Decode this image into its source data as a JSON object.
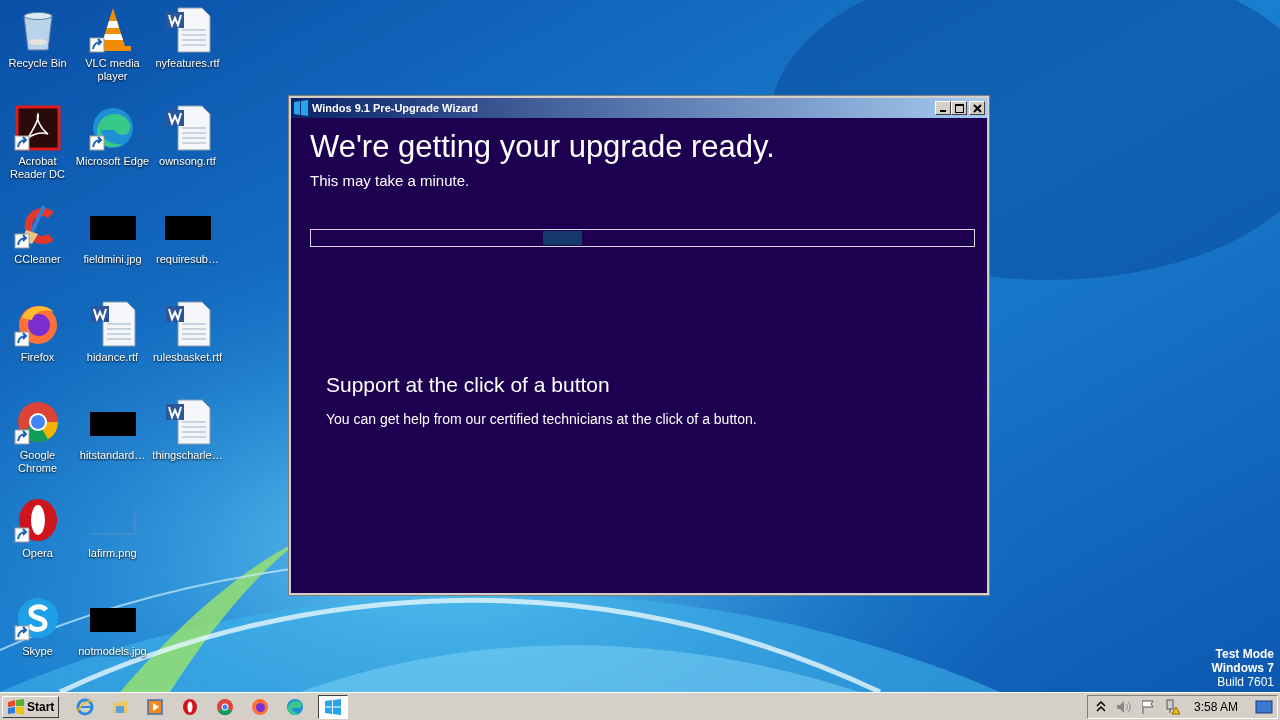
{
  "desktop": {
    "icons": [
      {
        "label": "Recycle Bin",
        "kind": "recycle",
        "shortcut": false
      },
      {
        "label": "Acrobat Reader DC",
        "kind": "acrobat",
        "shortcut": true
      },
      {
        "label": "CCleaner",
        "kind": "ccleaner",
        "shortcut": true
      },
      {
        "label": "Firefox",
        "kind": "firefox",
        "shortcut": true
      },
      {
        "label": "Google Chrome",
        "kind": "chrome",
        "shortcut": true
      },
      {
        "label": "Opera",
        "kind": "opera",
        "shortcut": true
      },
      {
        "label": "Skype",
        "kind": "skype",
        "shortcut": true
      },
      {
        "label": "VLC media player",
        "kind": "vlc",
        "shortcut": true
      },
      {
        "label": "Microsoft Edge",
        "kind": "edge",
        "shortcut": true
      },
      {
        "label": "fieldmini.jpg",
        "kind": "thumb-black",
        "shortcut": false
      },
      {
        "label": "hidance.rtf",
        "kind": "word",
        "shortcut": false
      },
      {
        "label": "hitstandard…",
        "kind": "thumb-black",
        "shortcut": false
      },
      {
        "label": "lafirm.png",
        "kind": "thumb-blank",
        "shortcut": false
      },
      {
        "label": "notmodels.jpg",
        "kind": "thumb-black",
        "shortcut": false
      },
      {
        "label": "nyfeatures.rtf",
        "kind": "word",
        "shortcut": false
      },
      {
        "label": "ownsong.rtf",
        "kind": "word",
        "shortcut": false
      },
      {
        "label": "requiresub…",
        "kind": "thumb-black",
        "shortcut": false
      },
      {
        "label": "rulesbasket.rtf",
        "kind": "word",
        "shortcut": false
      },
      {
        "label": "thingscharle…",
        "kind": "word",
        "shortcut": false
      }
    ]
  },
  "window": {
    "title": "Windos 9.1 Pre-Upgrade Wizard",
    "heading": "We're getting your upgrade ready.",
    "subheading": "This may take a minute.",
    "progress": {
      "indeterminate": true
    },
    "support_heading": "Support at the click of a button",
    "support_text": "You can get help from our certified technicians at the click of a button."
  },
  "system_notice": [
    "Test Mode",
    "Windows 7",
    "Build 7601"
  ],
  "taskbar": {
    "start_label": "Start",
    "quick_launch": [
      {
        "kind": "ie",
        "selected": false
      },
      {
        "kind": "explorer",
        "selected": false
      },
      {
        "kind": "media",
        "selected": false
      },
      {
        "kind": "opera",
        "selected": false
      },
      {
        "kind": "chrome",
        "selected": false
      },
      {
        "kind": "firefox",
        "selected": false
      },
      {
        "kind": "edge",
        "selected": false
      },
      {
        "kind": "windows",
        "selected": true
      }
    ],
    "clock": "3:58 AM"
  }
}
